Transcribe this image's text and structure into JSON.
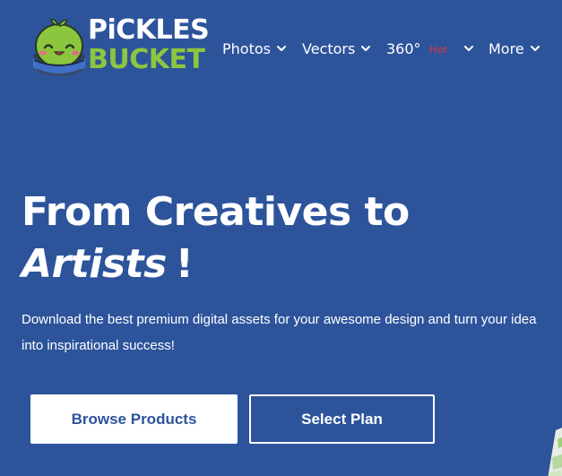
{
  "colors": {
    "background": "#2d549b",
    "logo_green": "#8cc63f",
    "hot_badge": "#e8323c",
    "button_text_blue": "#2d549b"
  },
  "logo": {
    "line1": "PiCKLES",
    "line2": "BUCKET",
    "mascot_icon": "pickle-bucket-mascot"
  },
  "nav": {
    "items": [
      {
        "label": "Photos",
        "icon": "chevron-down-icon"
      },
      {
        "label": "Vectors",
        "icon": "chevron-down-icon"
      },
      {
        "label": "360°",
        "badge": "Hot",
        "icon": "chevron-down-icon"
      },
      {
        "label": "More",
        "icon": "chevron-down-icon"
      }
    ]
  },
  "hero": {
    "title_line1": "From Creatives to",
    "title_italic": "Artists",
    "title_suffix": "!",
    "description": "Download the best premium digital assets for your awesome design and turn your idea into inspirational success!"
  },
  "buttons": {
    "browse_label": "Browse Products",
    "plan_label": "Select Plan"
  }
}
